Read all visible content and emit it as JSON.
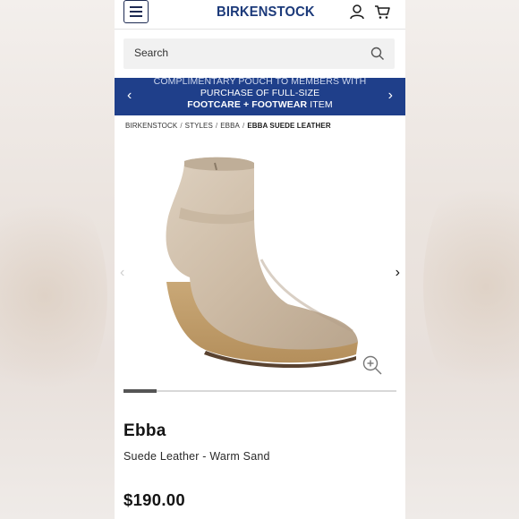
{
  "header": {
    "brand": "BIRKENSTOCK",
    "menu_icon": "hamburger-menu-icon",
    "account_icon": "user-icon",
    "cart_icon": "cart-icon"
  },
  "search": {
    "placeholder": "Search",
    "icon": "search-icon"
  },
  "promo": {
    "line1": "COMPLIMENTARY POUCH TO MEMBERS WITH",
    "line2": "PURCHASE OF FULL-SIZE",
    "line3_bold": "FOOTCARE + FOOTWEAR",
    "line3_rest": "ITEM",
    "prev_icon": "chevron-left-icon",
    "next_icon": "chevron-right-icon",
    "bg_color": "#1f3f8a"
  },
  "breadcrumb": {
    "items": [
      "BIRKENSTOCK",
      "STYLES",
      "EBBA"
    ],
    "current": "EBBA SUEDE LEATHER",
    "separator": "/"
  },
  "gallery": {
    "image": "product-image-ebba-boot",
    "prev_icon": "chevron-left-icon",
    "next_icon": "chevron-right-icon",
    "zoom_icon": "zoom-in-icon",
    "progress": 0.12
  },
  "product": {
    "name": "Ebba",
    "variant": "Suede Leather - Warm Sand",
    "price": "$190.00"
  }
}
